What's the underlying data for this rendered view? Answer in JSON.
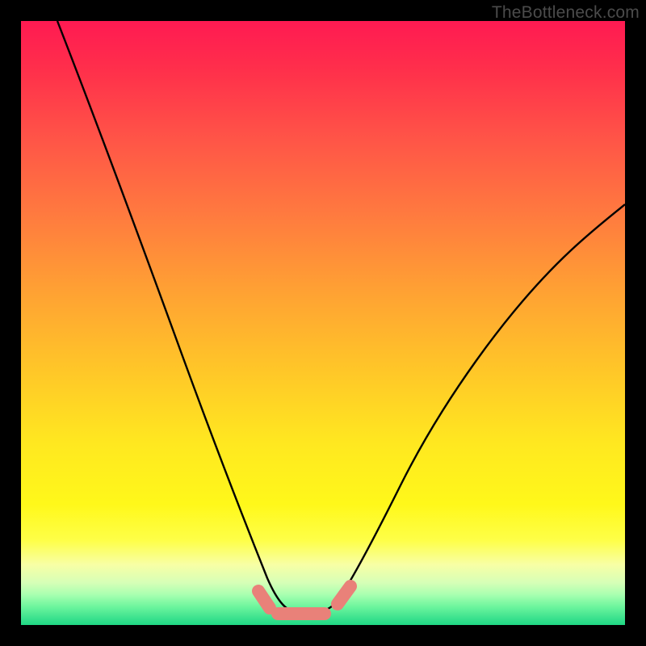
{
  "watermark": "TheBottleneck.com",
  "colors": {
    "background": "#000000",
    "curve_stroke": "#000000",
    "marker_fill": "#e98179",
    "gradient_stops": [
      "#ff1a52",
      "#ff2f4b",
      "#ff5647",
      "#ff7a3f",
      "#ffa233",
      "#ffc728",
      "#ffe820",
      "#fff81a",
      "#feff48",
      "#f8ffa5",
      "#d6ffb7",
      "#a8ffb0",
      "#6cf59d",
      "#38e08d",
      "#1fd884"
    ]
  },
  "chart_data": {
    "type": "line",
    "title": "",
    "xlabel": "",
    "ylabel": "",
    "xlim": [
      0,
      100
    ],
    "ylim": [
      0,
      100
    ],
    "legend": false,
    "grid": false,
    "series": [
      {
        "name": "bottleneck-curve",
        "x": [
          6,
          10,
          15,
          20,
          25,
          30,
          35,
          38,
          40,
          42,
          44,
          46,
          48,
          50,
          52,
          55,
          60,
          65,
          70,
          75,
          80,
          85,
          90,
          95,
          100
        ],
        "y": [
          100,
          90,
          78,
          65,
          52,
          40,
          27,
          18,
          11,
          6,
          3,
          2,
          2,
          2,
          3,
          5,
          10,
          17,
          24,
          31,
          38,
          45,
          51,
          57,
          62
        ]
      }
    ],
    "markers": [
      {
        "name": "valley-left-edge",
        "x": 40,
        "y": 7
      },
      {
        "name": "valley-floor-1",
        "x": 44,
        "y": 2
      },
      {
        "name": "valley-floor-2",
        "x": 47,
        "y": 2
      },
      {
        "name": "valley-floor-3",
        "x": 50,
        "y": 2
      },
      {
        "name": "valley-right-edge",
        "x": 55,
        "y": 6
      }
    ],
    "annotations": []
  }
}
